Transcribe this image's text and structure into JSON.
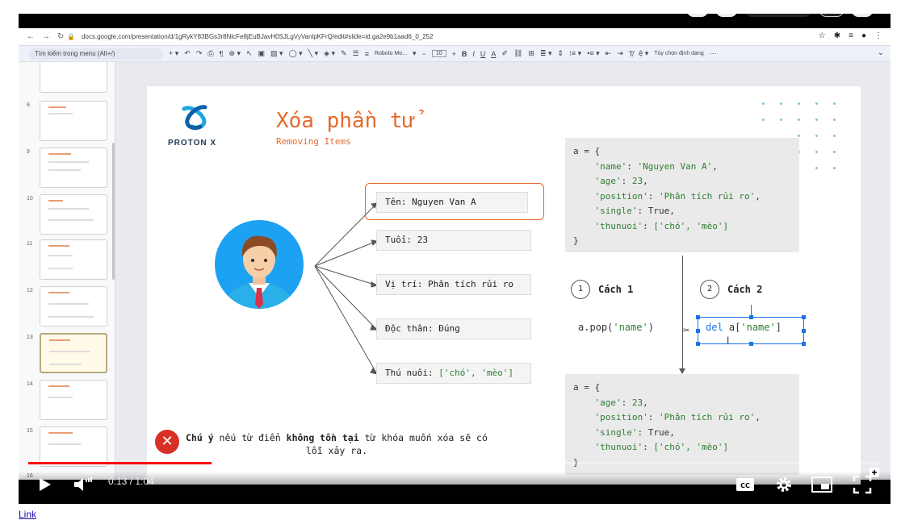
{
  "browser": {
    "url": "docs.google.com/presentation/d/1gRykY83BGs3r8NlcFe8jEuBJavH0SJLgVyVanlpKFrQ/edit#slide=id.ga2e9b1aad6_0_252",
    "menu_search": "Tìm kiếm trong menu (Alt+/)",
    "font_name": "Roboto Mo...",
    "font_size": "10",
    "format_options": "Tùy chọn định dạng"
  },
  "filmstrip": {
    "slide_numbers": [
      "8",
      "9",
      "10",
      "11",
      "12",
      "13",
      "14",
      "15",
      "16"
    ]
  },
  "slide": {
    "logo_text": "PROTON X",
    "title": "Xóa phần tử",
    "subtitle": "Removing Items",
    "info": {
      "name": "Tên: Nguyen Van A",
      "age": "Tuổi: 23",
      "position": "Vị trí: Phân tích rủi ro",
      "single": "Độc thân: Đúng",
      "pets_label": "Thú nuôi: ",
      "pets_value": "['chó', 'mèo']"
    },
    "code_before": {
      "open": "a = {",
      "line1_key": "'name'",
      "line1_val": "'Nguyen Van A'",
      "line2_key": "'age'",
      "line2_val": "23",
      "line3_key": "'position'",
      "line3_val": "'Phân tích rủi ro'",
      "line4_key": "'single'",
      "line4_val": "True",
      "line5_key": "'thunuoi'",
      "line5_val": "['chó', 'mèo']",
      "close": "}"
    },
    "method1": {
      "num": "1",
      "label": "Cách 1",
      "code_prefix": "a.pop(",
      "code_arg": "'name'",
      "code_suffix": ")"
    },
    "method2": {
      "num": "2",
      "label": "Cách 2",
      "code_kw": "del",
      "code_rest_prefix": " a[",
      "code_arg": "'name'",
      "code_suffix": "]"
    },
    "code_after": {
      "open": "a = {",
      "line1_key": "'age'",
      "line1_val": "23",
      "line2_key": "'position'",
      "line2_val": "'Phân tích rủi ro'",
      "line3_key": "'single'",
      "line3_val": "True",
      "line4_key": "'thunuoi'",
      "line4_val": "['chó', 'mèo']",
      "close": "}"
    },
    "note": {
      "part1": "Chú ý",
      "part2": " nếu từ điển ",
      "part3": "không tồn tại",
      "part4": " từ khóa muốn xóa sẽ có",
      "part5": "lỗi xảy ra."
    }
  },
  "player": {
    "time": "0:13 / 1:04",
    "progress": 0.215
  },
  "footer": {
    "link": "Link"
  },
  "colors": {
    "accent": "#e66a2c",
    "string_green": "#2e7d32",
    "progress_red": "#ff0000",
    "selection_blue": "#1a73e8"
  }
}
